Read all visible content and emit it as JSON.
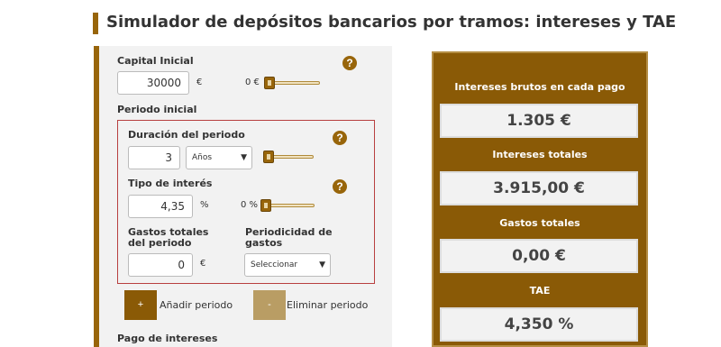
{
  "title": "Simulador de depósitos bancarios por tramos: intereses y TAE",
  "capital": {
    "label": "Capital Inicial",
    "value": "30000",
    "unit": "€",
    "slider_value": "0 €",
    "help_icon": "question-mark"
  },
  "periodo_inicial": {
    "label": "Periodo inicial",
    "duracion": {
      "label": "Duración del periodo",
      "value": "3",
      "unit_select": "Años",
      "help_icon": "question-mark"
    },
    "tipo_interes": {
      "label": "Tipo de interés",
      "value": "4,35",
      "unit": "%",
      "slider_value": "0 %",
      "help_icon": "question-mark"
    },
    "gastos": {
      "label": "Gastos totales del periodo",
      "value": "0",
      "unit": "€"
    },
    "periodicidad": {
      "label": "Periodicidad de gastos",
      "selected": "Seleccionar"
    }
  },
  "buttons": {
    "add_symbol": "+",
    "add_label": "Añadir periodo",
    "delete_symbol": "-",
    "delete_label": "Eliminar periodo"
  },
  "pago_intereses": {
    "label": "Pago de intereses"
  },
  "results": {
    "intereses_brutos_label": "Intereses brutos en cada pago",
    "intereses_brutos_value": "1.305 €",
    "intereses_totales_label": "Intereses totales",
    "intereses_totales_value": "3.915,00 €",
    "gastos_totales_label": "Gastos totales",
    "gastos_totales_value": "0,00 €",
    "tae_label": "TAE",
    "tae_value": "4,350 %"
  },
  "colors": {
    "accent": "#98650a",
    "panel_bg": "#8a5a06",
    "border_red": "#b84040"
  }
}
